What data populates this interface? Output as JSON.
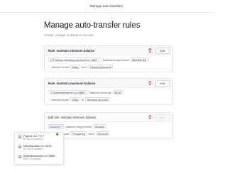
{
  "topbar": {
    "title": "Manage auto-transfers"
  },
  "page": {
    "title": "Manage auto-transfer rules",
    "subtitle": "Create, change or delete a new rule"
  },
  "cards": [
    {
      "title": "Rule: maintain minimum balance",
      "edit_label": "Edit",
      "line1": {
        "account": "Primary checking account •••• 4567",
        "text": "balance drops below",
        "amount": "$50,000.00"
      },
      "line2": {
        "prefix": "transfer funds",
        "frequency": "Daily",
        "from_label": "from",
        "source": "treasury account"
      }
    },
    {
      "title": "Rule: maintain maximum balance",
      "edit_label": "Edit",
      "line1": {
        "account": "Advertisements •••• 8885",
        "text": "balance exceeds",
        "amount": "$0.00"
      },
      "line2": {
        "prefix": "transfer funds",
        "frequency": "Daily",
        "to_label": "to",
        "source": "treasury account"
      }
    },
    {
      "title": "Edit rule: maintain minimum balance",
      "edit_label": "Save",
      "line1": {
        "account": "Account",
        "text": "balance drops below",
        "amount": "Amount"
      },
      "line2": {
        "prefix": "transfer funds",
        "frequency": "Frequency",
        "from_label": "from",
        "source": "Account"
      }
    }
  ],
  "dropdown": {
    "options": [
      {
        "name": "Payroll •••• 7777",
        "available": "$4,000.00 available"
      },
      {
        "name": "Merchandise •••• 4443",
        "available": "$1,234.00 available"
      },
      {
        "name": "Advertisements •••• 8885",
        "available": "$500.00 available"
      }
    ]
  },
  "colors": {
    "accent": "#2f5fd0",
    "danger": "#d64545",
    "border": "#e4e6ea"
  }
}
